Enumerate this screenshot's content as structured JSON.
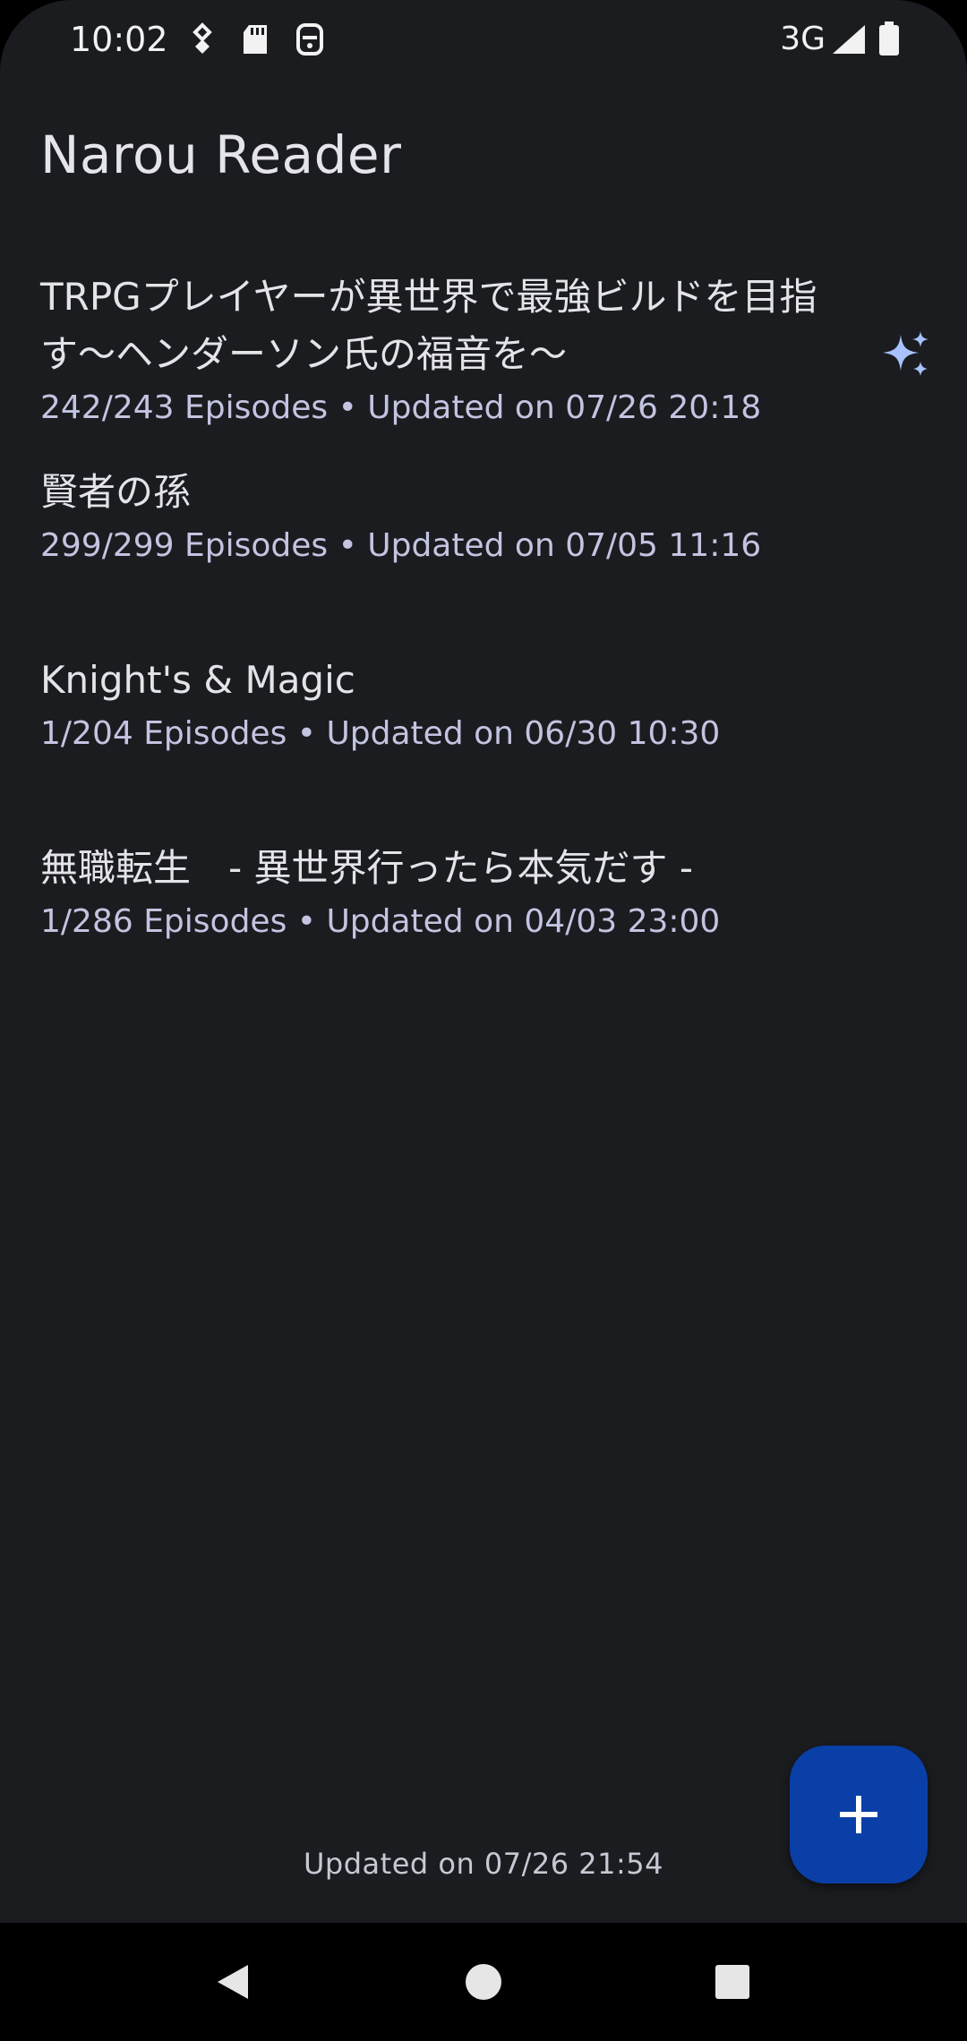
{
  "status_bar": {
    "time": "10:02",
    "network": "3G",
    "icons": [
      "vpn-key-icon",
      "sd-card-icon",
      "notification-icon",
      "signal-icon",
      "battery-icon"
    ]
  },
  "app": {
    "title": "Narou Reader"
  },
  "novels": [
    {
      "title": "TRPGプレイヤーが異世界で最強ビルドを目指す〜ヘンダーソン氏の福音を〜",
      "meta": "242/243 Episodes • Updated on 07/26 20:18",
      "has_new": true
    },
    {
      "title": "賢者の孫",
      "meta": "299/299 Episodes • Updated on 07/05 11:16",
      "has_new": false
    },
    {
      "title": "Knight's & Magic",
      "meta": "1/204 Episodes • Updated on 06/30 10:30",
      "has_new": false
    },
    {
      "title": "無職転生　- 異世界行ったら本気だす -",
      "meta": "1/286 Episodes • Updated on 04/03 23:00",
      "has_new": false
    }
  ],
  "footer": {
    "updated": "Updated on 07/26 21:54"
  },
  "fab": {
    "icon": "plus-icon"
  },
  "nav": {
    "icons": [
      "back-icon",
      "home-icon",
      "recents-icon"
    ]
  },
  "colors": {
    "background": "#1a1c20",
    "accent": "#0a3fa8",
    "sparkle": "#a8c2ff",
    "meta_text": "#c2c4e0"
  }
}
